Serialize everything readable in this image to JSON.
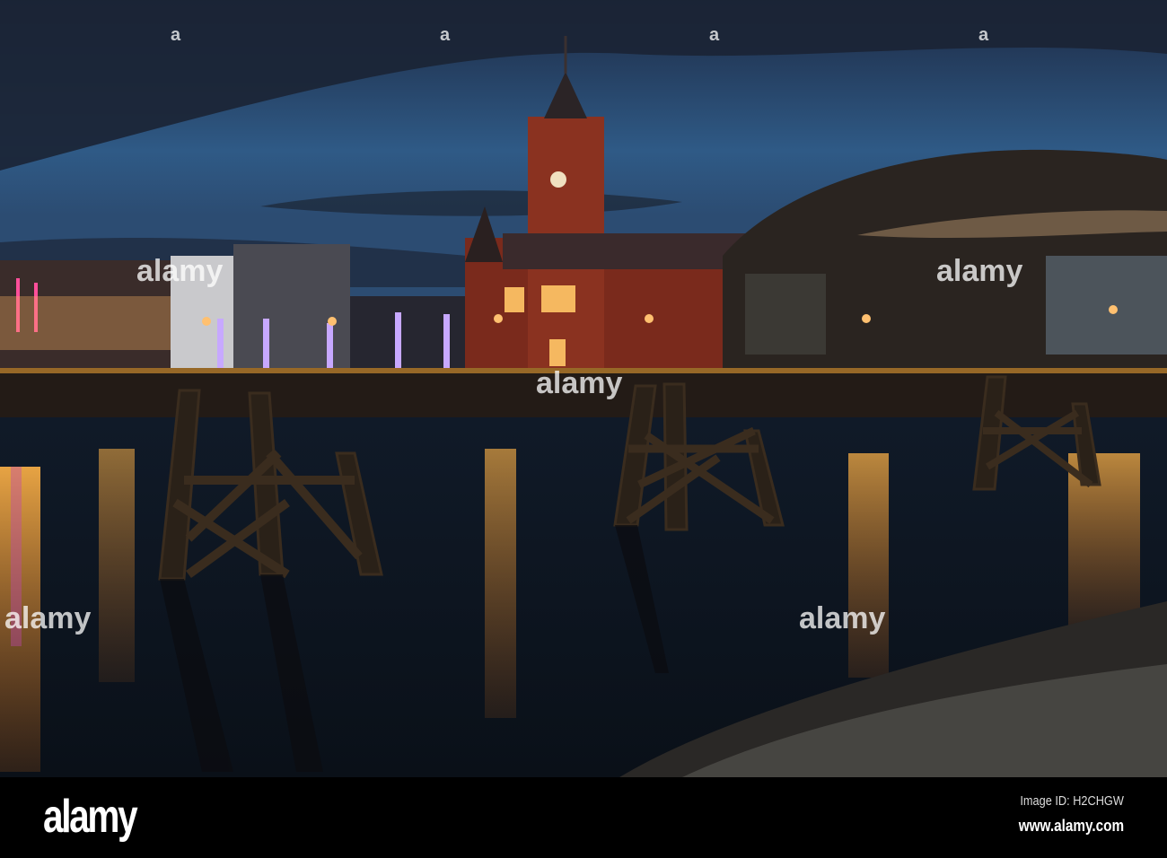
{
  "photo": {
    "subject": "Cardiff Bay at dusk"
  },
  "watermark": {
    "text": "alamy",
    "glyph": "a"
  },
  "footer": {
    "logo": "alamy",
    "image_id": "Image ID: H2CHGW",
    "website": "www.alamy.com"
  }
}
